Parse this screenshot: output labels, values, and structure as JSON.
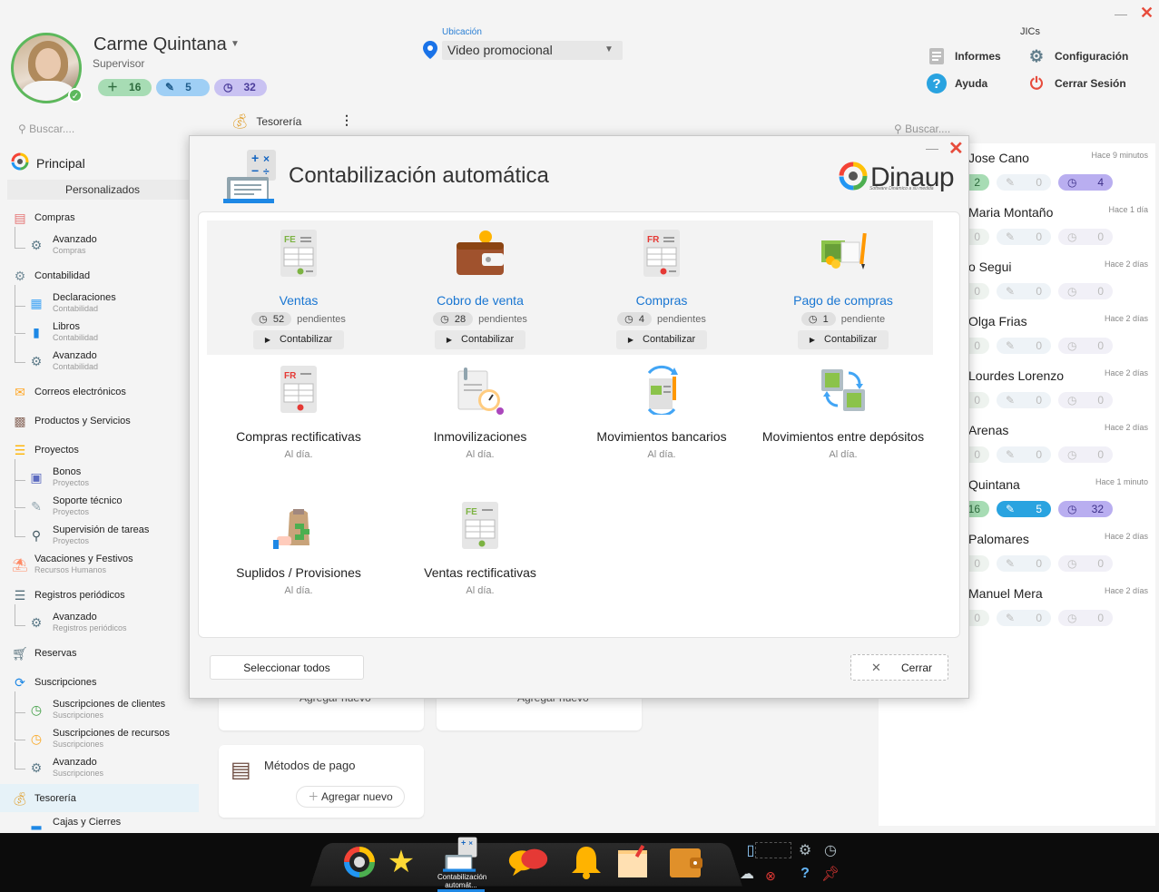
{
  "header": {
    "user_name": "Carme Quintana",
    "user_role": "Supervisor",
    "badges": {
      "added": "16",
      "edited": "5",
      "history": "32"
    },
    "location_label": "Ubicación",
    "location_value": "Video promocional",
    "jics_label": "JICs",
    "links": {
      "reports": "Informes",
      "config": "Configuración",
      "help": "Ayuda",
      "logout": "Cerrar Sesión"
    }
  },
  "search": {
    "left_placeholder": "Buscar....",
    "right_placeholder": "Buscar...."
  },
  "sidebar": {
    "principal": "Principal",
    "personalizados": "Personalizados",
    "compras": "Compras",
    "compras_avanzado": "Avanzado",
    "compras_avanzado_sub": "Compras",
    "contabilidad": "Contabilidad",
    "declaraciones": "Declaraciones",
    "declaraciones_sub": "Contabilidad",
    "libros": "Libros",
    "libros_sub": "Contabilidad",
    "cont_avanzado": "Avanzado",
    "cont_avanzado_sub": "Contabilidad",
    "correos": "Correos electrónicos",
    "productos": "Productos y Servicios",
    "proyectos": "Proyectos",
    "bonos": "Bonos",
    "bonos_sub": "Proyectos",
    "soporte": "Soporte técnico",
    "soporte_sub": "Proyectos",
    "supervision": "Supervisión de tareas",
    "supervision_sub": "Proyectos",
    "vacaciones": "Vacaciones y Festivos",
    "vacaciones_sub": "Recursos Humanos",
    "registros": "Registros periódicos",
    "reg_avanzado": "Avanzado",
    "reg_avanzado_sub": "Registros periódicos",
    "reservas": "Reservas",
    "suscripciones": "Suscripciones",
    "susc_clientes": "Suscripciones de clientes",
    "susc_clientes_sub": "Suscripciones",
    "susc_recursos": "Suscripciones de recursos",
    "susc_recursos_sub": "Suscripciones",
    "susc_avanzado": "Avanzado",
    "susc_avanzado_sub": "Suscripciones",
    "tesoreria": "Tesorería",
    "cajas": "Cajas y Cierres"
  },
  "center": {
    "tab_label": "Tesorería",
    "payment_methods": "Métodos de pago",
    "add_new": "Agregar nuevo",
    "add_new_2": "Agregar nuevo",
    "add_new_3": "Agregar nuevo"
  },
  "right_panel": [
    {
      "name": "Jose Cano",
      "time": "Hace 9 minutos",
      "a": "2",
      "b": "0",
      "c": "4"
    },
    {
      "name": "Maria Montaño",
      "time": "Hace 1 día",
      "a": "0",
      "b": "0",
      "c": "0"
    },
    {
      "name": "o Segui",
      "time": "Hace 2 días",
      "a": "0",
      "b": "0",
      "c": "0"
    },
    {
      "name": "Olga Frias",
      "time": "Hace 2 días",
      "a": "0",
      "b": "0",
      "c": "0"
    },
    {
      "name": "Lourdes Lorenzo",
      "time": "Hace 2 días",
      "a": "0",
      "b": "0",
      "c": "0"
    },
    {
      "name": "Arenas",
      "time": "Hace 2 días",
      "a": "0",
      "b": "0",
      "c": "0"
    },
    {
      "name": "Quintana",
      "time": "Hace 1 minuto",
      "a": "16",
      "b": "5",
      "c": "32"
    },
    {
      "name": "Palomares",
      "time": "Hace 2 días",
      "a": "0",
      "b": "0",
      "c": "0"
    },
    {
      "name": "Manuel Mera",
      "time": "Hace 2 días",
      "a": "0",
      "b": "0",
      "c": "0"
    }
  ],
  "modal": {
    "title": "Contabilización automática",
    "brand": "Dinaup",
    "brand_tagline": "Software Dinámico a su medida",
    "action_label": "Contabilizar",
    "tiles_top": [
      {
        "name": "Ventas",
        "count": "52",
        "status": "pendientes"
      },
      {
        "name": "Cobro de venta",
        "count": "28",
        "status": "pendientes"
      },
      {
        "name": "Compras",
        "count": "4",
        "status": "pendientes"
      },
      {
        "name": "Pago de compras",
        "count": "1",
        "status": "pendiente"
      }
    ],
    "tiles_bottom": [
      {
        "name": "Compras rectificativas",
        "status": "Al día."
      },
      {
        "name": "Inmovilizaciones",
        "status": "Al día."
      },
      {
        "name": "Movimientos bancarios",
        "status": "Al día."
      },
      {
        "name": "Movimientos entre depósitos",
        "status": "Al día."
      },
      {
        "name": "Suplidos / Provisiones",
        "status": "Al día."
      },
      {
        "name": "Ventas rectificativas",
        "status": "Al día."
      }
    ],
    "select_all": "Seleccionar todos",
    "close": "Cerrar"
  },
  "taskbar": {
    "active_label": "Contabilización automát..."
  },
  "colors": {
    "accent": "#1976d2",
    "close": "#e74c3c",
    "green_badge": "#a7dcb4",
    "blue_badge": "#9fcff5",
    "purple_badge": "#c9c2f2"
  }
}
